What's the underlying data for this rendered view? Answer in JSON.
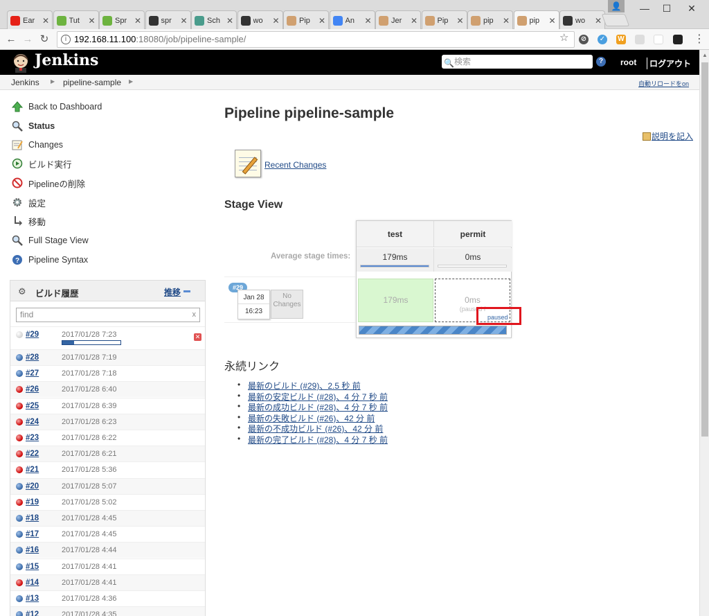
{
  "browser": {
    "tabs": [
      {
        "label": "Ear",
        "icon": "youtube-icon",
        "color": "#e62117"
      },
      {
        "label": "Tut",
        "icon": "spring-icon",
        "color": "#6db33f"
      },
      {
        "label": "Spr",
        "icon": "spring-icon",
        "color": "#6db33f"
      },
      {
        "label": "spr",
        "icon": "github-icon",
        "color": "#333333"
      },
      {
        "label": "Sch",
        "icon": "s-icon",
        "color": "#4a9c8c"
      },
      {
        "label": "wo",
        "icon": "github-icon",
        "color": "#333333"
      },
      {
        "label": "Pip",
        "icon": "jenkins-icon",
        "color": "#d0a070"
      },
      {
        "label": "An",
        "icon": "google-icon",
        "color": "#4285f4"
      },
      {
        "label": "Jer",
        "icon": "jenkins-icon",
        "color": "#d0a070"
      },
      {
        "label": "Pip",
        "icon": "jenkins-icon",
        "color": "#d0a070"
      },
      {
        "label": "pip",
        "icon": "jenkins-icon",
        "color": "#d0a070"
      },
      {
        "label": "pip",
        "icon": "jenkins-icon",
        "color": "#d0a070"
      },
      {
        "label": "wo",
        "icon": "github-icon",
        "color": "#333333"
      }
    ],
    "url_host": "192.168.11.100",
    "url_path": ":18080/job/pipeline-sample/"
  },
  "header": {
    "title": "Jenkins",
    "search_placeholder": "検索",
    "user": "root",
    "logout": "ログアウト"
  },
  "breadcrumb": {
    "items": [
      "Jenkins",
      "pipeline-sample"
    ],
    "auto_refresh": "自動リロードをon"
  },
  "sidebar": {
    "tasks": [
      {
        "label": "Back to Dashboard",
        "icon": "up-arrow-icon"
      },
      {
        "label": "Status",
        "icon": "magnifier-icon"
      },
      {
        "label": "Changes",
        "icon": "notepad-icon"
      },
      {
        "label": "ビルド実行",
        "icon": "clock-icon"
      },
      {
        "label": "Pipelineの削除",
        "icon": "no-entry-icon"
      },
      {
        "label": "設定",
        "icon": "gear-icon"
      },
      {
        "label": "移動",
        "icon": "move-icon"
      },
      {
        "label": "Full Stage View",
        "icon": "magnifier-icon"
      },
      {
        "label": "Pipeline Syntax",
        "icon": "help-icon"
      }
    ]
  },
  "build_history": {
    "title": "ビルド履歴",
    "trend": "推移",
    "filter_placeholder": "find",
    "builds": [
      {
        "num": "#29",
        "date": "2017/01/28 7:23",
        "status": "grey",
        "progress": 1.0
      },
      {
        "num": "#28",
        "date": "2017/01/28 7:19",
        "status": "blue"
      },
      {
        "num": "#27",
        "date": "2017/01/28 7:18",
        "status": "blue"
      },
      {
        "num": "#26",
        "date": "2017/01/28 6:40",
        "status": "red"
      },
      {
        "num": "#25",
        "date": "2017/01/28 6:39",
        "status": "red"
      },
      {
        "num": "#24",
        "date": "2017/01/28 6:23",
        "status": "red"
      },
      {
        "num": "#23",
        "date": "2017/01/28 6:22",
        "status": "red"
      },
      {
        "num": "#22",
        "date": "2017/01/28 6:21",
        "status": "red"
      },
      {
        "num": "#21",
        "date": "2017/01/28 5:36",
        "status": "red"
      },
      {
        "num": "#20",
        "date": "2017/01/28 5:07",
        "status": "blue"
      },
      {
        "num": "#19",
        "date": "2017/01/28 5:02",
        "status": "red"
      },
      {
        "num": "#18",
        "date": "2017/01/28 4:45",
        "status": "blue"
      },
      {
        "num": "#17",
        "date": "2017/01/28 4:45",
        "status": "blue"
      },
      {
        "num": "#16",
        "date": "2017/01/28 4:44",
        "status": "blue"
      },
      {
        "num": "#15",
        "date": "2017/01/28 4:41",
        "status": "blue"
      },
      {
        "num": "#14",
        "date": "2017/01/28 4:41",
        "status": "red"
      },
      {
        "num": "#13",
        "date": "2017/01/28 4:36",
        "status": "blue"
      },
      {
        "num": "#12",
        "date": "2017/01/28 4:35",
        "status": "blue"
      }
    ]
  },
  "main": {
    "title": "Pipeline pipeline-sample",
    "edit_description": "説明を記入",
    "recent_changes": "Recent Changes",
    "stage_view_title": "Stage View",
    "stage_view": {
      "stages": [
        "test",
        "permit"
      ],
      "avg_label": "Average stage times:",
      "avg_times": [
        "179ms",
        "0ms"
      ],
      "avg_fill": [
        1.0,
        0.0
      ],
      "build": {
        "badge": "#29",
        "date": "Jan 28",
        "time": "16:23",
        "changes": "No Changes",
        "cells": [
          "179ms",
          "0ms"
        ],
        "permit_sub": "(paused f",
        "paused": "paused"
      }
    },
    "permalinks_title": "永続リンク",
    "permalinks": [
      "最新のビルド (#29)、2.5 秒 前",
      "最新の安定ビルド (#28)、4 分 7 秒 前",
      "最新の成功ビルド (#28)、4 分 7 秒 前",
      "最新の失敗ビルド (#26)、42 分 前",
      "最新の不成功ビルド (#26)、42 分 前",
      "最新の完了ビルド (#28)、4 分 7 秒 前"
    ]
  },
  "colors": {
    "link": "#204a87",
    "success_cell": "#d9f7d0",
    "highlight": "#e0161e"
  }
}
